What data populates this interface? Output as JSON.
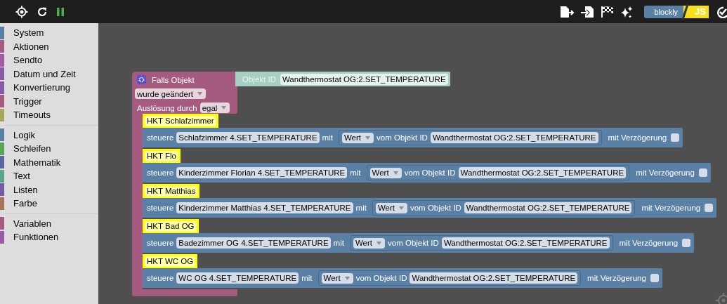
{
  "toolbar": {
    "mode_left": "blockly",
    "mode_right": "JS"
  },
  "sidebar": {
    "groups": [
      {
        "items": [
          {
            "label": "System",
            "color": "#5b80a5"
          },
          {
            "label": "Aktionen",
            "color": "#a55b80"
          },
          {
            "label": "Sendto",
            "color": "#a55ba5"
          },
          {
            "label": "Datum und Zeit",
            "color": "#8a5ba5"
          },
          {
            "label": "Konvertierung",
            "color": "#8a5ba5"
          },
          {
            "label": "Trigger",
            "color": "#a55b80"
          },
          {
            "label": "Timeouts",
            "color": "#a5a55b"
          }
        ]
      },
      {
        "items": [
          {
            "label": "Logik",
            "color": "#5b80a5"
          },
          {
            "label": "Schleifen",
            "color": "#5ba55b"
          },
          {
            "label": "Mathematik",
            "color": "#5b67a5"
          },
          {
            "label": "Text",
            "color": "#5ba58c"
          },
          {
            "label": "Listen",
            "color": "#745ba5"
          },
          {
            "label": "Farbe",
            "color": "#a5745b"
          }
        ]
      },
      {
        "items": [
          {
            "label": "Variablen",
            "color": "#a55b80"
          },
          {
            "label": "Funktionen",
            "color": "#995ba5"
          }
        ]
      }
    ]
  },
  "trigger_block": {
    "title": "Falls Objekt",
    "object_label": "Objekt ID",
    "object_value": "Wandthermostat OG:2.SET_TEMPERATURE",
    "event": "wurde geändert",
    "trigger_label": "Auslösung durch",
    "trigger_value": "egal"
  },
  "statements": [
    {
      "comment": "HKT Schlafzimmer",
      "prefix": "steuere",
      "target": "Schlafzimmer 4.SET_TEMPERATURE",
      "with_label": "mit",
      "value_dropdown": "Wert",
      "from_label": "vom Objekt ID",
      "source": "Wandthermostat OG:2.SET_TEMPERATURE",
      "delay_label": "mit Verzögerung",
      "delay_checked": false
    },
    {
      "comment": "HKT Flo",
      "prefix": "steuere",
      "target": "Kinderzimmer Florian 4.SET_TEMPERATURE",
      "with_label": "mit",
      "value_dropdown": "Wert",
      "from_label": "vom Objekt ID",
      "source": "Wandthermostat OG:2.SET_TEMPERATURE",
      "delay_label": "mit Verzögerung",
      "delay_checked": false
    },
    {
      "comment": "HKT Matthias",
      "prefix": "steuere",
      "target": "Kinderzimmer Matthias 4.SET_TEMPERATURE",
      "with_label": "mit",
      "value_dropdown": "Wert",
      "from_label": "vom Objekt ID",
      "source": "Wandthermostat OG:2.SET_TEMPERATURE",
      "delay_label": "mit Verzögerung",
      "delay_checked": false
    },
    {
      "comment": "HKT Bad OG",
      "prefix": "steuere",
      "target": "Badezimmer OG 4.SET_TEMPERATURE",
      "with_label": "mit",
      "value_dropdown": "Wert",
      "from_label": "vom Objekt ID",
      "source": "Wandthermostat OG:2.SET_TEMPERATURE",
      "delay_label": "mit Verzögerung",
      "delay_checked": false
    },
    {
      "comment": "HKT WC OG",
      "prefix": "steuere",
      "target": "WC OG 4.SET_TEMPERATURE",
      "with_label": "mit",
      "value_dropdown": "Wert",
      "from_label": "vom Objekt ID",
      "source": "Wandthermostat OG:2.SET_TEMPERATURE",
      "delay_label": "mit Verzögerung",
      "delay_checked": false
    }
  ]
}
